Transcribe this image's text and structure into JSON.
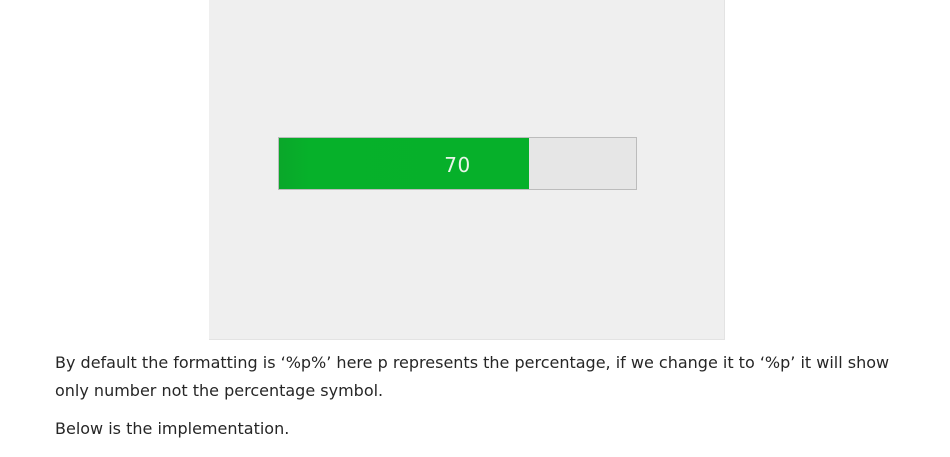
{
  "demo": {
    "progress_value": 70,
    "progress_label": "70",
    "fill_color": "#06b02a",
    "track_color": "#e6e6e6"
  },
  "article": {
    "paragraph_1": "By default the formatting is ‘%p%’ here p represents the percentage, if we change it to ‘%p’ it will show only number not the percentage symbol.",
    "paragraph_2": "Below is the implementation."
  }
}
